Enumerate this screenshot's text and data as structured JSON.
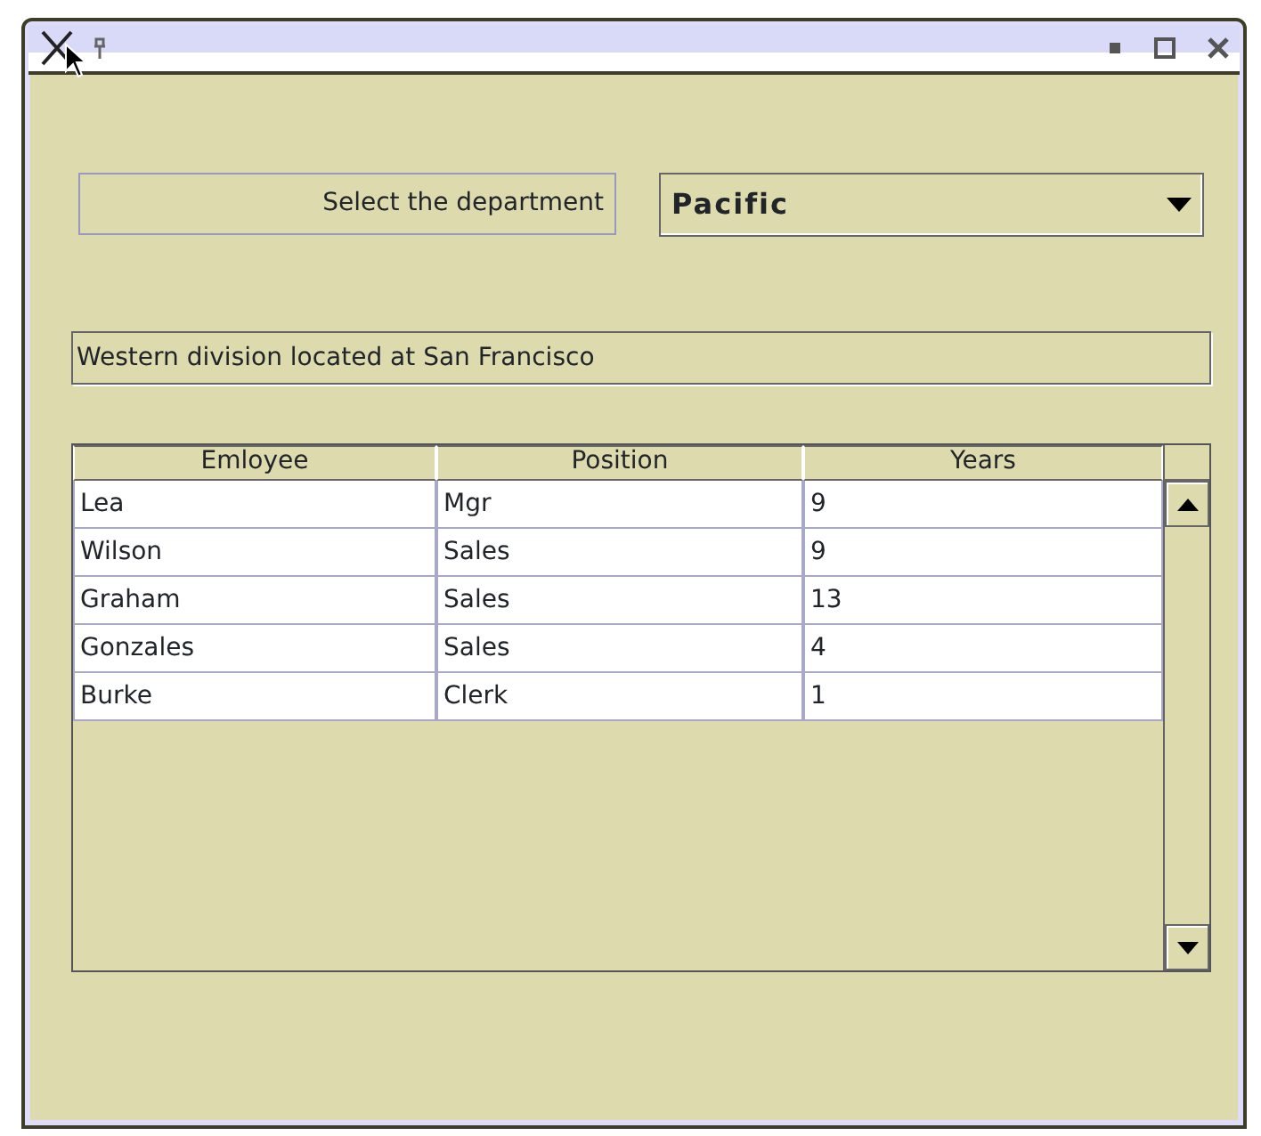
{
  "label": "Select the department",
  "department": {
    "value": "Pacific"
  },
  "description": {
    "value": "Western division located at San Francisco"
  },
  "table": {
    "columns": [
      "Emloyee",
      "Position",
      "Years"
    ],
    "rows": [
      [
        "Lea",
        "Mgr",
        "9"
      ],
      [
        "Wilson",
        "Sales",
        "9"
      ],
      [
        "Graham",
        "Sales",
        "13"
      ],
      [
        "Gonzales",
        "Sales",
        "4"
      ],
      [
        "Burke",
        "Clerk",
        "1"
      ]
    ]
  }
}
